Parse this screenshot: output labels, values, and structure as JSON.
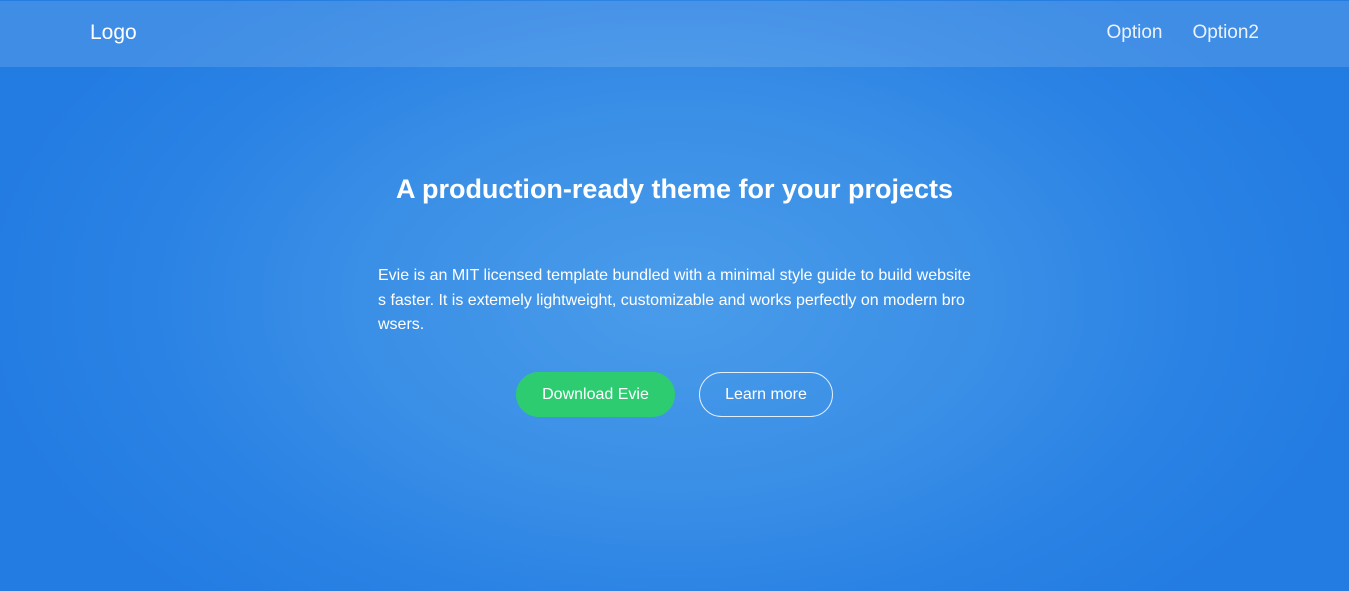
{
  "header": {
    "logo": "Logo",
    "nav": [
      "Option",
      "Option2"
    ]
  },
  "hero": {
    "title": "A production-ready theme for your projects",
    "description": "Evie is an MIT licensed template bundled with a minimal style guide to build websites faster. It is extemely lightweight, customizable and works perfectly on modern browsers.",
    "primary_button": "Download Evie",
    "secondary_button": "Learn more"
  },
  "colors": {
    "background": "#2a82e4",
    "accent_green": "#2ecc71",
    "text": "#ffffff"
  }
}
